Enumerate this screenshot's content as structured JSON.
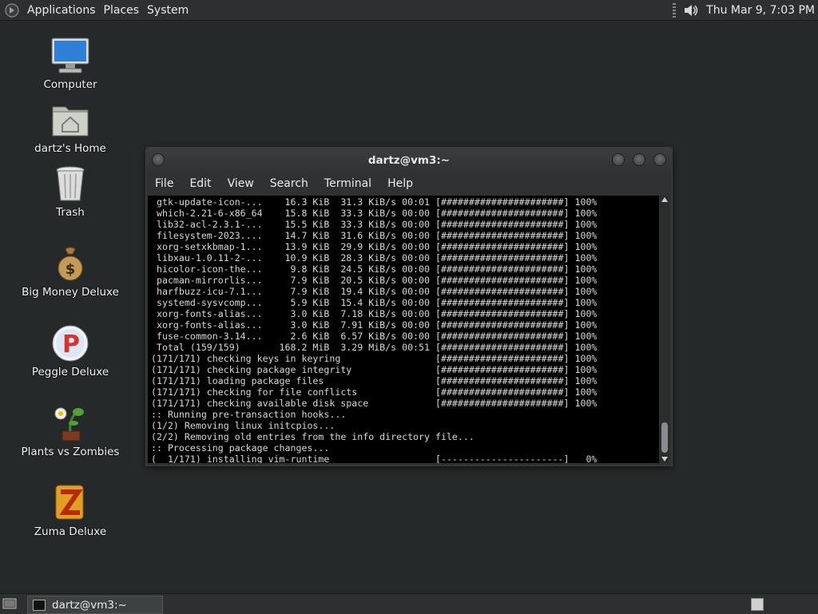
{
  "top_panel": {
    "menus": [
      "Applications",
      "Places",
      "System"
    ],
    "clock": "Thu Mar  9,  7:03 PM"
  },
  "desktop": {
    "icons": [
      {
        "label": "Computer",
        "icon": "computer-icon"
      },
      {
        "label": "dartz's Home",
        "icon": "home-folder-icon"
      },
      {
        "label": "Trash",
        "icon": "trash-icon"
      },
      {
        "label": "Big Money Deluxe",
        "icon": "money-bag-icon"
      },
      {
        "label": "Peggle Deluxe",
        "icon": "peggle-icon"
      },
      {
        "label": "Plants vs Zombies",
        "icon": "plants-vs-zombies-icon"
      },
      {
        "label": "Zuma Deluxe",
        "icon": "zuma-icon"
      }
    ]
  },
  "terminal": {
    "title": "dartz@vm3:~",
    "menu": [
      "File",
      "Edit",
      "View",
      "Search",
      "Terminal",
      "Help"
    ],
    "lines": [
      " gtk-update-icon-...    16.3 KiB  31.3 KiB/s 00:01 [######################] 100%",
      " which-2.21-6-x86_64    15.8 KiB  33.3 KiB/s 00:00 [######################] 100%",
      " lib32-acl-2.3.1-...    15.5 KiB  33.3 KiB/s 00:00 [######################] 100%",
      " filesystem-2023....    14.7 KiB  31.6 KiB/s 00:00 [######################] 100%",
      " xorg-setxkbmap-1...    13.9 KiB  29.9 KiB/s 00:00 [######################] 100%",
      " libxau-1.0.11-2-...    10.9 KiB  28.3 KiB/s 00:00 [######################] 100%",
      " hicolor-icon-the...     9.8 KiB  24.5 KiB/s 00:00 [######################] 100%",
      " pacman-mirrorlis...     7.9 KiB  20.5 KiB/s 00:00 [######################] 100%",
      " harfbuzz-icu-7.1...     7.9 KiB  19.4 KiB/s 00:00 [######################] 100%",
      " systemd-sysvcomp...     5.9 KiB  15.4 KiB/s 00:00 [######################] 100%",
      " xorg-fonts-alias...     3.0 KiB  7.18 KiB/s 00:00 [######################] 100%",
      " xorg-fonts-alias...     3.0 KiB  7.91 KiB/s 00:00 [######################] 100%",
      " fuse-common-3.14...     2.6 KiB  6.57 KiB/s 00:00 [######################] 100%",
      " Total (159/159)       168.2 MiB  3.29 MiB/s 00:51 [######################] 100%",
      "(171/171) checking keys in keyring                 [######################] 100%",
      "(171/171) checking package integrity               [######################] 100%",
      "(171/171) loading package files                    [######################] 100%",
      "(171/171) checking for file conflicts              [######################] 100%",
      "(171/171) checking available disk space            [######################] 100%",
      ":: Running pre-transaction hooks...",
      "(1/2) Removing linux initcpios...",
      "(2/2) Removing old entries from the info directory file...",
      ":: Processing package changes...",
      "(  1/171) installing vim-runtime                   [----------------------]   0%"
    ]
  },
  "taskbar": {
    "task_label": "dartz@vm3:~"
  }
}
